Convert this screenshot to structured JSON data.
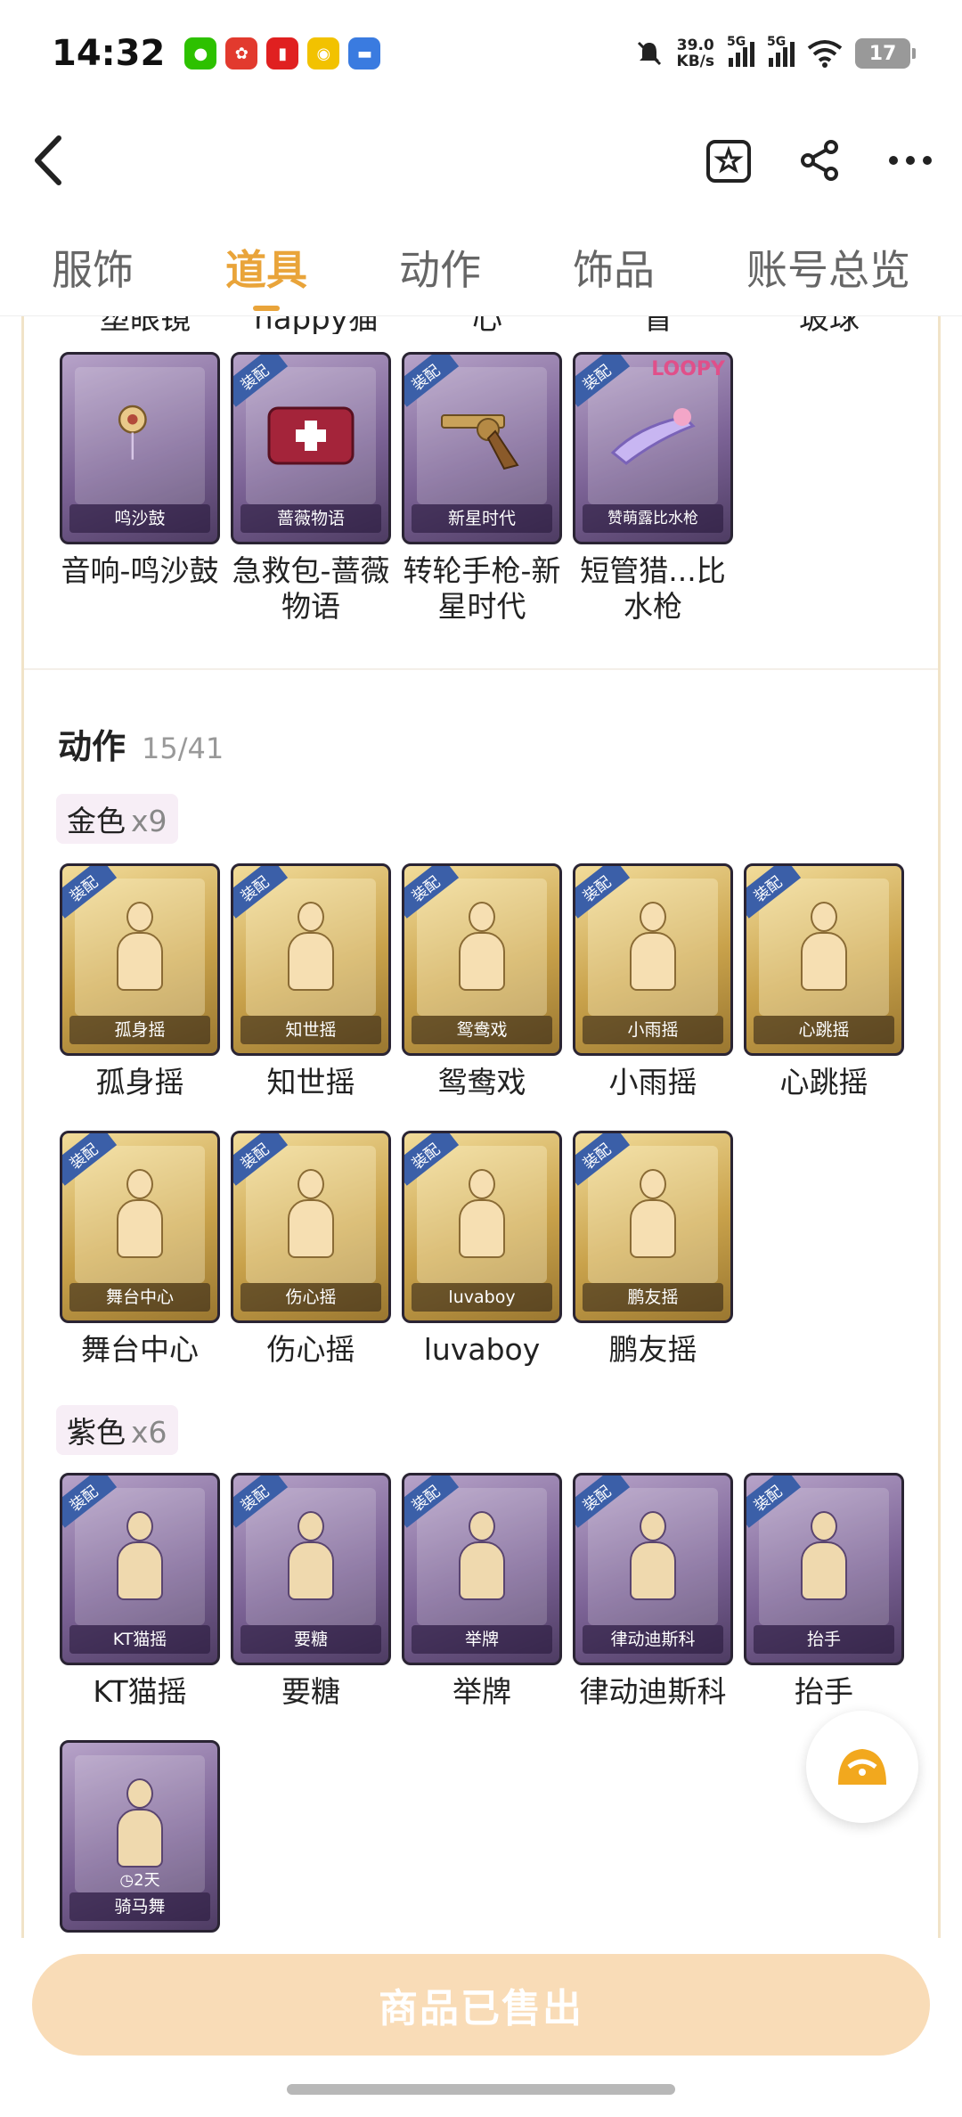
{
  "status": {
    "time": "14:32",
    "speed_value": "39.0",
    "speed_unit": "KB/s",
    "net1": "5G",
    "net2": "5G",
    "battery": "17"
  },
  "tabs": [
    "服饰",
    "道具",
    "动作",
    "饰品",
    "账号总览"
  ],
  "active_tab": "道具",
  "cutoff_names": [
    "塑眼镜",
    "happy猫",
    "心",
    "冒",
    "玻球"
  ],
  "props_row": [
    {
      "label": "鸣沙鼓",
      "name": "音响-鸣沙鼓"
    },
    {
      "label": "蔷薇物语",
      "name": "急救包-蔷薇物语",
      "badge": "装配"
    },
    {
      "label": "新星时代",
      "name": "转轮手枪-新星时代",
      "badge": "装配"
    },
    {
      "label": "赞萌露比水枪",
      "name": "短管猎...比水枪",
      "badge": "装配",
      "logo": "LOOPY"
    }
  ],
  "actions_section": {
    "title": "动作",
    "count": "15/41"
  },
  "gold": {
    "label": "金色",
    "count": "x9"
  },
  "gold_row1": [
    {
      "label": "孤身摇",
      "name": "孤身摇",
      "badge": "装配"
    },
    {
      "label": "知世摇",
      "name": "知世摇",
      "badge": "装配"
    },
    {
      "label": "鸳鸯戏",
      "name": "鸳鸯戏",
      "badge": "装配"
    },
    {
      "label": "小雨摇",
      "name": "小雨摇",
      "badge": "装配"
    },
    {
      "label": "心跳摇",
      "name": "心跳摇",
      "badge": "装配"
    }
  ],
  "gold_row2": [
    {
      "label": "舞台中心",
      "name": "舞台中心",
      "badge": "装配"
    },
    {
      "label": "伤心摇",
      "name": "伤心摇",
      "badge": "装配"
    },
    {
      "label": "luvaboy",
      "name": "luvaboy",
      "badge": "装配"
    },
    {
      "label": "鹏友摇",
      "name": "鹏友摇",
      "badge": "装配"
    }
  ],
  "purple": {
    "label": "紫色",
    "count": "x6"
  },
  "purple_row1": [
    {
      "label": "KT猫摇",
      "name": "KT猫摇",
      "badge": "装配"
    },
    {
      "label": "要糖",
      "name": "要糖",
      "badge": "装配"
    },
    {
      "label": "举牌",
      "name": "举牌",
      "badge": "装配"
    },
    {
      "label": "律动迪斯科",
      "name": "律动迪斯科",
      "badge": "装配"
    },
    {
      "label": "抬手",
      "name": "抬手",
      "badge": "装配"
    }
  ],
  "purple_row2": [
    {
      "label": "骑马舞",
      "timer": "2天"
    }
  ],
  "bottom_button": "商品已售出",
  "colors": {
    "accent": "#e9a43a",
    "sold_button": "#f9dcb7",
    "badge": "#3b5fa8"
  }
}
